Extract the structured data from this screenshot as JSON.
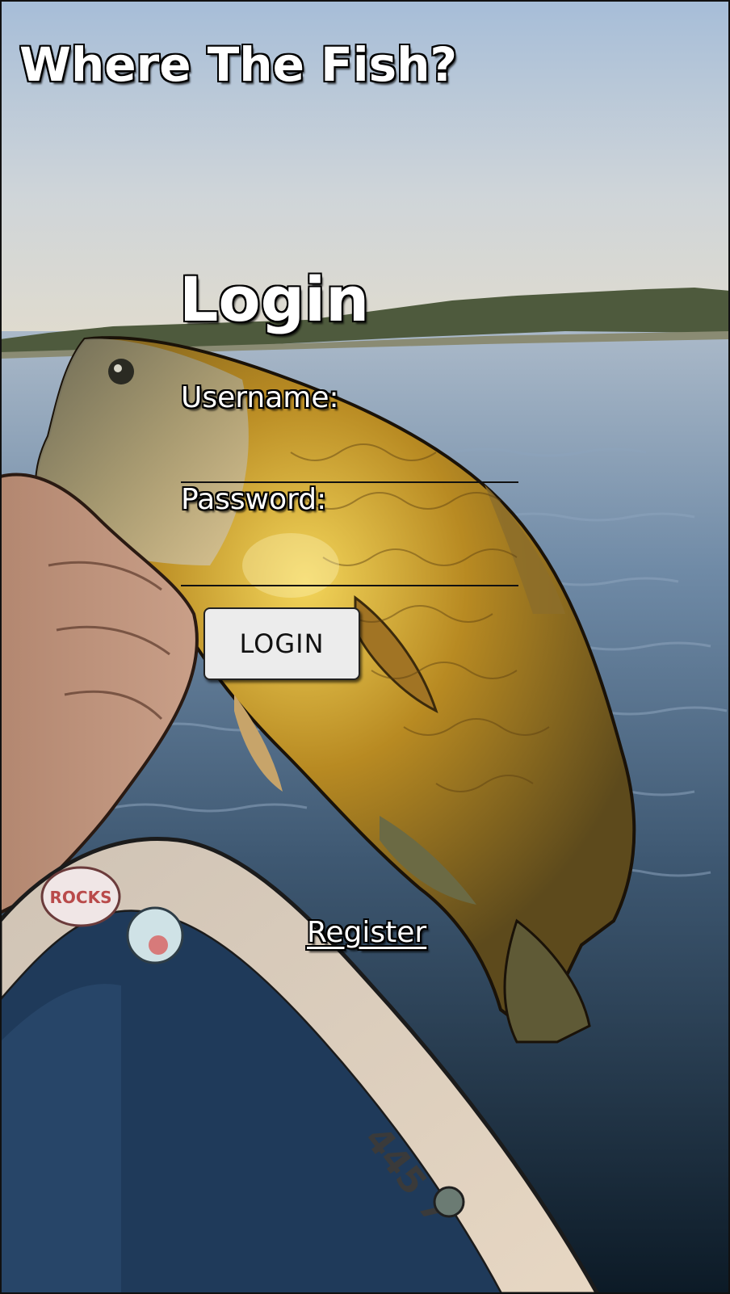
{
  "app": {
    "title": "Where The Fish?"
  },
  "login": {
    "heading": "Login",
    "username_label": "Username:",
    "username_value": "",
    "password_label": "Password:",
    "password_value": "",
    "submit_label": "LOGIN"
  },
  "register": {
    "link_label": "Register"
  },
  "background": {
    "sticker_text": "ROCKS",
    "hull_text": "445 7"
  },
  "colors": {
    "sky_top": "#a9bfd8",
    "sky_bottom": "#dcd9cf",
    "water": "#3b5470",
    "fish_gold": "#b98c2a",
    "boat_rail": "#d8c8b4",
    "text_outline": "#000000",
    "text_fill": "#ffffff",
    "button_fill": "#ececec"
  }
}
